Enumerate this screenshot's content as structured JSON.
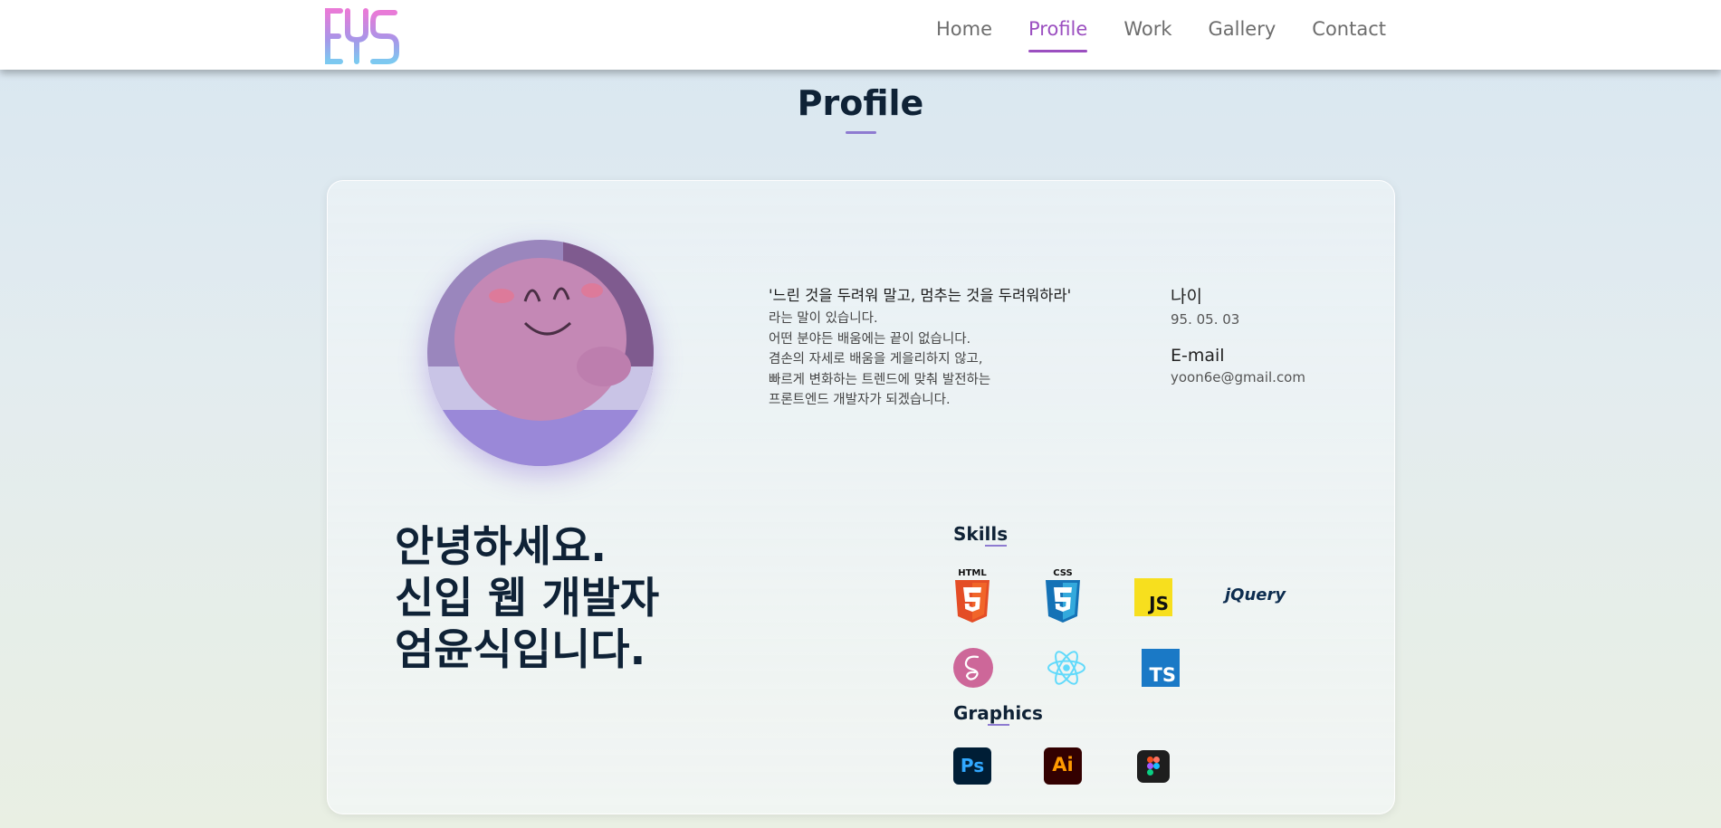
{
  "header": {
    "logo_text": "EYS",
    "nav": [
      "Home",
      "Profile",
      "Work",
      "Gallery",
      "Contact"
    ],
    "active": "Profile"
  },
  "section": {
    "title": "Profile"
  },
  "quote": {
    "title": "'느린 것을 두려워 말고, 멈추는 것을 두려워하라'",
    "lines": [
      "라는 말이 있습니다.",
      "어떤 분야든 배움에는 끝이 없습니다.",
      "겸손의 자세로 배움을 게을리하지 않고,",
      "빠르게 변화하는 트렌드에 맞춰 발전하는",
      "프론트엔드 개발자가 되겠습니다."
    ]
  },
  "info": {
    "age_label": "나이",
    "age_value": "95. 05. 03",
    "email_label": "E-mail",
    "email_value": "yoon6e@gmail.com"
  },
  "greeting": [
    "안녕하세요.",
    "신입 웹 개발자",
    "엄윤식입니다."
  ],
  "skills": {
    "heading": "Skills",
    "icons": [
      "html5-icon",
      "css3-icon",
      "javascript-icon",
      "jquery-icon",
      "sass-icon",
      "react-icon",
      "typescript-icon"
    ],
    "html_label": "HTML",
    "css_label": "CSS",
    "js_label": "JS",
    "jquery_label": "jQuery",
    "ts_label": "TS"
  },
  "graphics": {
    "heading": "Graphics",
    "icons": [
      "photoshop-icon",
      "illustrator-icon",
      "figma-icon"
    ],
    "ps_label": "Ps",
    "ai_label": "Ai"
  },
  "colors": {
    "accent": "#9b4fc0",
    "underline": "#8e7bd1",
    "title": "#0f2236",
    "nav": "#6d6d6d"
  }
}
